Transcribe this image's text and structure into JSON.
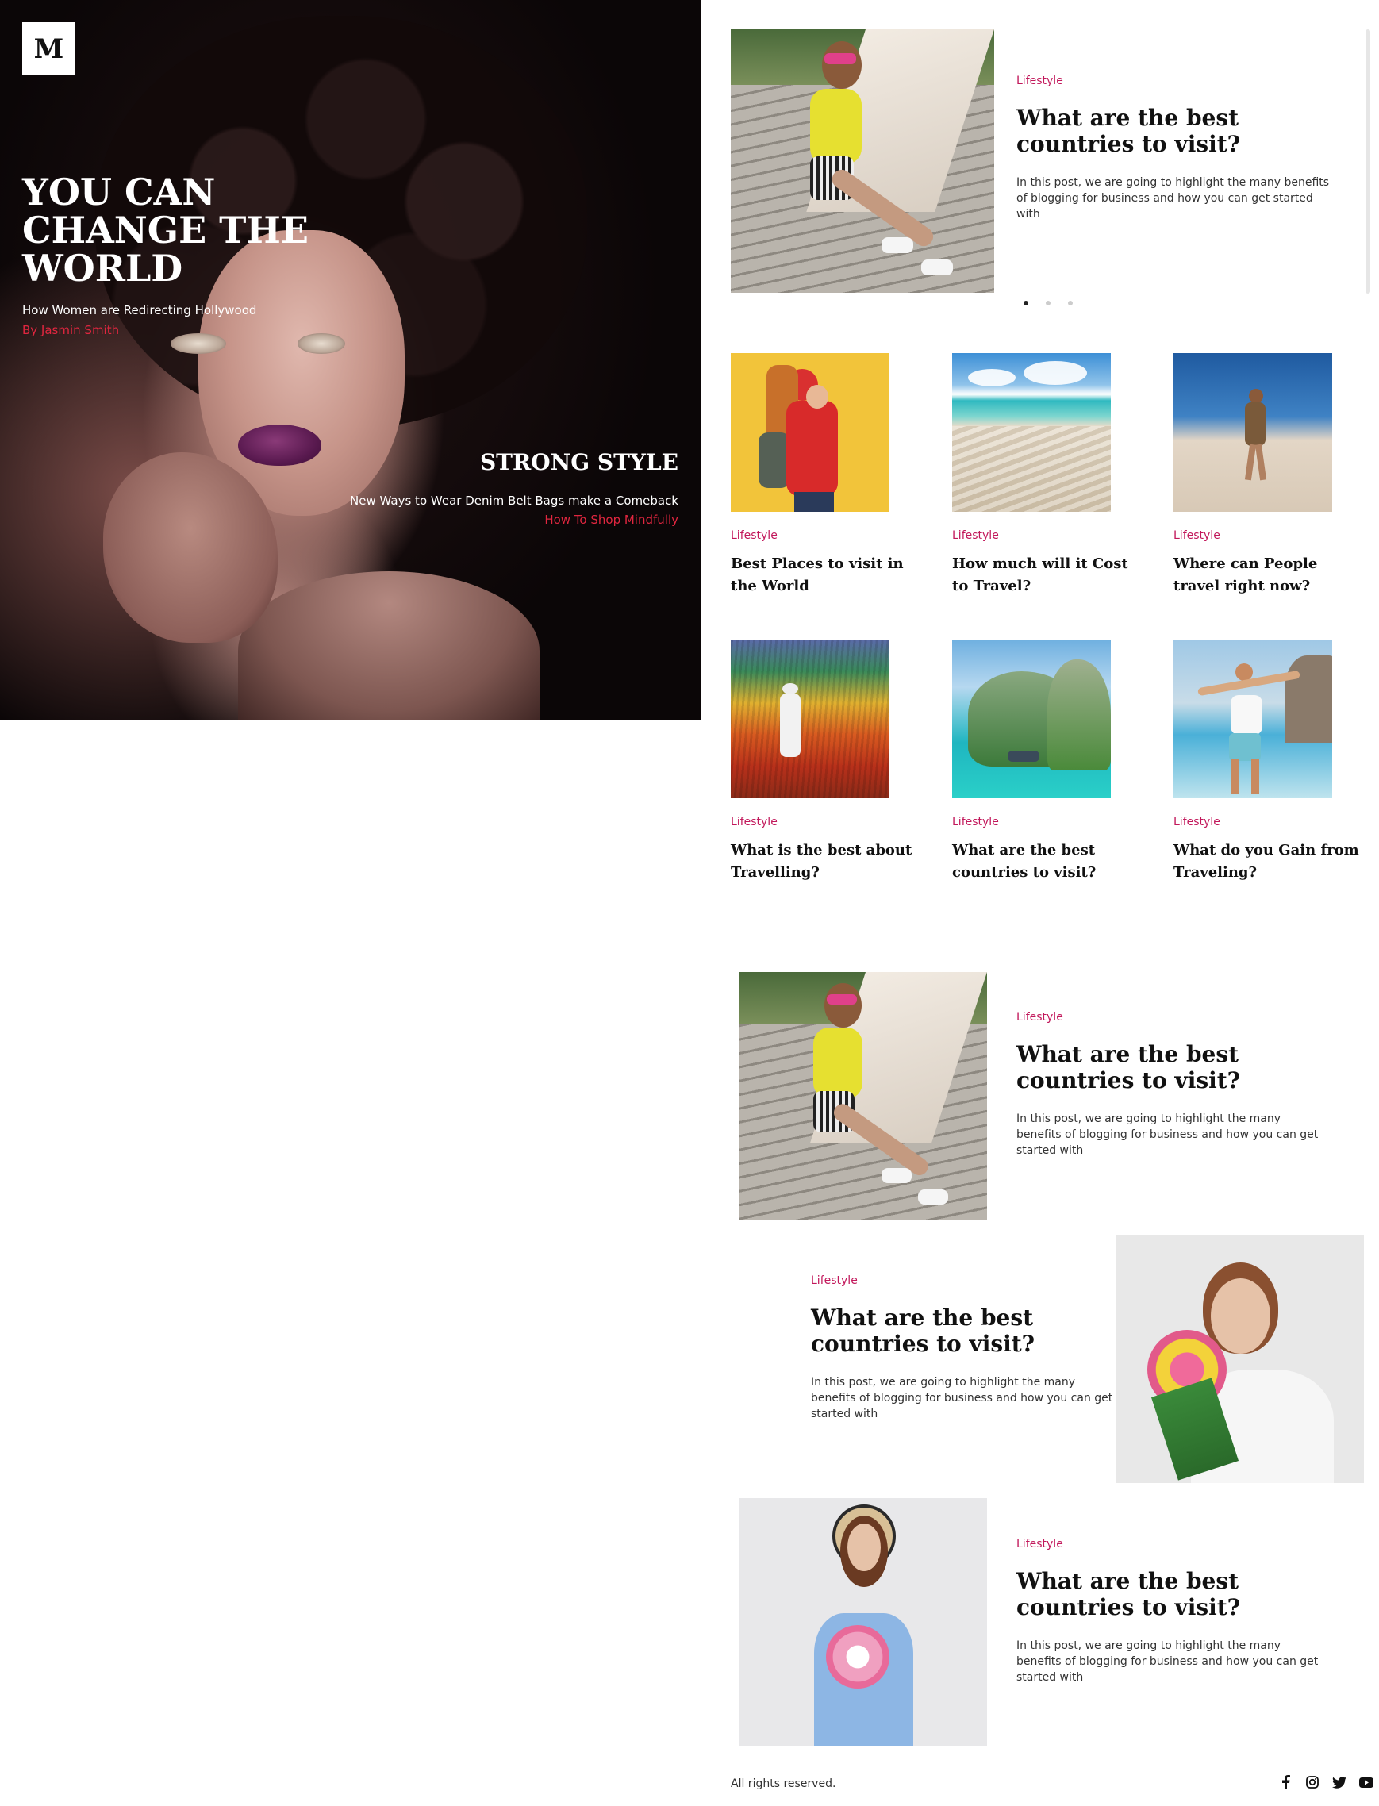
{
  "brand": {
    "logo_letter": "M"
  },
  "hero": {
    "title": "YOU CAN\nCHANGE THE\nWORLD",
    "subtitle": "How Women are Redirecting Hollywood",
    "author": "By Jasmin Smith",
    "secondary_title": "STRONG STYLE",
    "secondary_subtitle": "New Ways to Wear Denim Belt Bags make a Comeback",
    "secondary_link": "How To Shop Mindfully"
  },
  "featured_slider": {
    "category": "Lifestyle",
    "title": "What are the best countries to visit?",
    "excerpt": "In this post, we are going to highlight the many benefits of blogging for business and how you can get started with",
    "slide_count": 3,
    "active_slide": 1
  },
  "grid_posts": [
    {
      "category": "Lifestyle",
      "title": "Best Places to visit in the World"
    },
    {
      "category": "Lifestyle",
      "title": "How much will it Cost to Travel?"
    },
    {
      "category": "Lifestyle",
      "title": "Where can People travel right now?"
    },
    {
      "category": "Lifestyle",
      "title": "What is the best about Travelling?"
    },
    {
      "category": "Lifestyle",
      "title": "What are the best countries to visit?"
    },
    {
      "category": "Lifestyle",
      "title": "What do you Gain from Traveling?"
    }
  ],
  "list_posts": [
    {
      "category": "Lifestyle",
      "title": "What are the best countries to visit?",
      "excerpt": "In this post, we are going to highlight the many benefits of blogging for business and how you can get started with"
    },
    {
      "category": "Lifestyle",
      "title": "What are the best countries to visit?",
      "excerpt": "In this post, we are going to highlight the many benefits of blogging for business and how you can get started with"
    },
    {
      "category": "Lifestyle",
      "title": "What are the best countries to visit?",
      "excerpt": "In this post, we are going to highlight the many benefits of blogging for business and how you can get started with"
    }
  ],
  "footer": {
    "copyright": "All rights reserved.",
    "socials": [
      "facebook-icon",
      "instagram-icon",
      "twitter-icon",
      "youtube-icon"
    ]
  },
  "colors": {
    "accent_red": "#e0263f",
    "category_pink": "#c2185b",
    "text_dark": "#111111"
  }
}
